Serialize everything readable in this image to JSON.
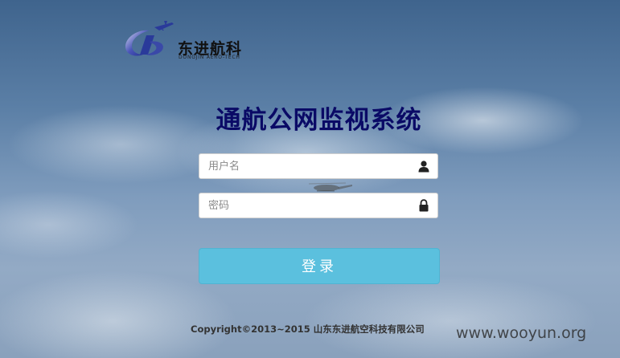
{
  "logo": {
    "name": "东进航科",
    "subtitle": "DONGJIN AERO-TECH"
  },
  "page_title": "通航公网监视系统",
  "login_form": {
    "username_placeholder": "用户名",
    "password_placeholder": "密码",
    "username_icon": "user-icon",
    "password_icon": "lock-icon",
    "login_label": "登录"
  },
  "footer": {
    "copyright": "Copyright©2013~2015 山东东进航空科技有限公司"
  },
  "watermark": "www.wooyun.org",
  "colors": {
    "title": "#0a0a66",
    "login_button": "#5bc0de",
    "sky": "#5b7fa6"
  }
}
